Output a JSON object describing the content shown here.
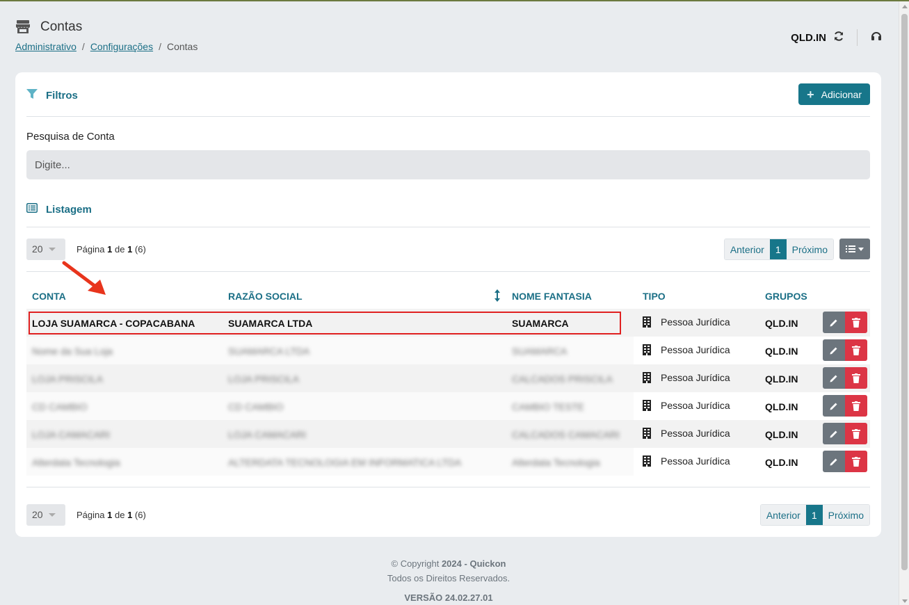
{
  "header": {
    "title": "Contas",
    "breadcrumb": [
      {
        "label": "Administrativo",
        "link": true
      },
      {
        "label": "Configurações",
        "link": true
      },
      {
        "label": "Contas",
        "link": false
      }
    ],
    "company": "QLD.IN"
  },
  "filters": {
    "title": "Filtros",
    "add_label": "Adicionar",
    "search_label": "Pesquisa de Conta",
    "search_placeholder": "Digite..."
  },
  "listing": {
    "title": "Listagem",
    "page_size": "20",
    "page_word": "Página",
    "page_current": "1",
    "of_word": "de",
    "page_total": "1",
    "count": "(6)",
    "prev_label": "Anterior",
    "next_label": "Próximo",
    "active_page": "1",
    "columns": {
      "conta": "CONTA",
      "razao": "RAZÃO SOCIAL",
      "fantasia": "NOME FANTASIA",
      "tipo": "TIPO",
      "grupos": "GRUPOS"
    },
    "rows": [
      {
        "conta": "LOJA SUAMARCA - COPACABANA",
        "razao": "SUAMARCA LTDA",
        "fantasia": "SUAMARCA",
        "tipo": "Pessoa Jurídica",
        "grupo": "QLD.IN",
        "blurred": false
      },
      {
        "conta": "Nome da Sua Loja",
        "razao": "SUAMARCA LTDA",
        "fantasia": "SUAMARCA",
        "tipo": "Pessoa Jurídica",
        "grupo": "QLD.IN",
        "blurred": true
      },
      {
        "conta": "LOJA PRISCILA",
        "razao": "LOJA PRISCILA",
        "fantasia": "CALCADOS PRISCILA",
        "tipo": "Pessoa Jurídica",
        "grupo": "QLD.IN",
        "blurred": true
      },
      {
        "conta": "CD CAMBIO",
        "razao": "CD CAMBIO",
        "fantasia": "CAMBIO TESTE",
        "tipo": "Pessoa Jurídica",
        "grupo": "QLD.IN",
        "blurred": true
      },
      {
        "conta": "LOJA CAMACARI",
        "razao": "LOJA CAMACARI",
        "fantasia": "CALCADOS CAMACARI",
        "tipo": "Pessoa Jurídica",
        "grupo": "QLD.IN",
        "blurred": true
      },
      {
        "conta": "Alterdata Tecnologia",
        "razao": "ALTERDATA TECNOLOGIA EM INFORMATICA LTDA",
        "fantasia": "Alterdata Tecnologia",
        "tipo": "Pessoa Jurídica",
        "grupo": "QLD.IN",
        "blurred": true
      }
    ]
  },
  "footer": {
    "copyright_prefix": "© Copyright",
    "year": "2024",
    "dash": "-",
    "brand": "Quickon",
    "rights": "Todos os Direitos Reservados.",
    "version": "VERSÃO 24.02.27.01"
  },
  "colors": {
    "primary": "#17768a",
    "danger": "#dc3545",
    "secondary": "#6c757d",
    "highlight": "#e02020"
  }
}
